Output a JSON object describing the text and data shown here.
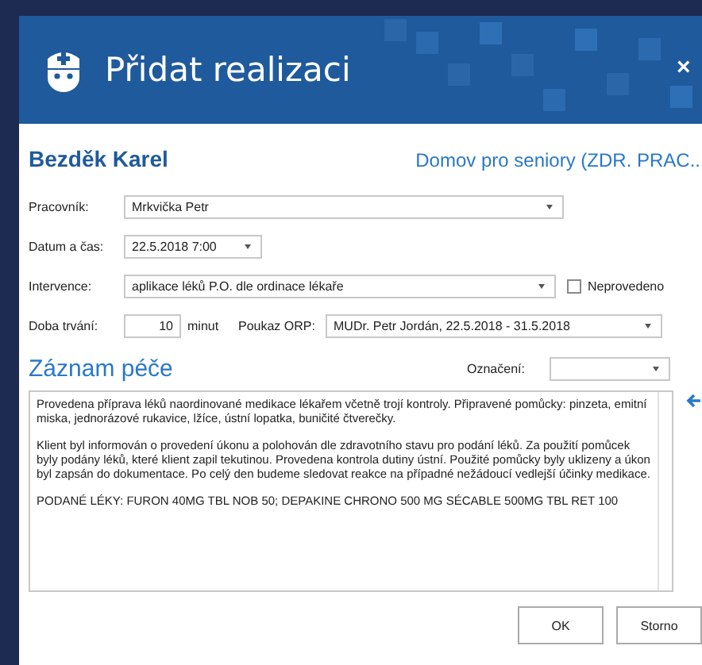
{
  "window": {
    "title": "Přidat realizaci",
    "close": "×"
  },
  "patient": {
    "name": "Bezděk Karel",
    "facility": "Domov pro seniory (ZDR. PRAC.."
  },
  "form": {
    "worker": {
      "label": "Pracovník:",
      "value": "Mrkvička Petr"
    },
    "datetime": {
      "label": "Datum a čas:",
      "value": "22.5.2018 7:00"
    },
    "intervention": {
      "label": "Intervence:",
      "value": "aplikace léků P.O. dle ordinace lékaře",
      "not_done": {
        "label": "Neprovedeno",
        "checked": false
      }
    },
    "duration": {
      "label": "Doba trvání:",
      "value": "10",
      "unit": "minut"
    },
    "order": {
      "label": "Poukaz ORP:",
      "value": "MUDr. Petr Jordán, 22.5.2018 - 31.5.2018"
    }
  },
  "care_record": {
    "title": "Záznam péče",
    "marking": {
      "label": "Označení:"
    },
    "paragraphs": [
      "Provedena příprava léků naordinované medikace lékařem včetně trojí kontroly. Připravené pomůcky: pinzeta, emitní miska, jednorázové rukavice, lžíce, ústní lopatka, buničité čtverečky.",
      "Klient byl informován o provedení úkonu a polohován dle zdravotního stavu pro podání léků. Za použití pomůcek byly podány léků, které klient zapil tekutinou. Provedena kontrola dutiny ústní. Použité pomůcky byly uklizeny a úkon byl zapsán do dokumentace. Po celý den budeme sledovat reakce na případné nežádoucí vedlejší účinky medikace.",
      "PODANÉ LÉKY: FURON 40MG TBL NOB 50; DEPAKINE CHRONO 500 MG SÉCABLE 500MG TBL RET 100"
    ]
  },
  "buttons": [
    "OK",
    "Storno"
  ]
}
